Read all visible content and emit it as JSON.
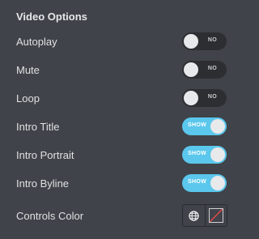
{
  "section": {
    "title": "Video Options"
  },
  "options": [
    {
      "label": "Autoplay",
      "state": "off",
      "toggle_text": "NO"
    },
    {
      "label": "Mute",
      "state": "off",
      "toggle_text": "NO"
    },
    {
      "label": "Loop",
      "state": "off",
      "toggle_text": "NO"
    },
    {
      "label": "Intro Title",
      "state": "on",
      "toggle_text": "SHOW"
    },
    {
      "label": "Intro Portrait",
      "state": "on",
      "toggle_text": "SHOW"
    },
    {
      "label": "Intro Byline",
      "state": "on",
      "toggle_text": "SHOW"
    }
  ],
  "controls_color": {
    "label": "Controls Color",
    "global_icon": "globe-icon",
    "swatch": "empty-color-swatch",
    "swatch_slash_color": "#e24b4b"
  },
  "colors": {
    "background": "#404349",
    "toggle_on": "#5bc7ec",
    "toggle_off": "#2c2e32"
  }
}
